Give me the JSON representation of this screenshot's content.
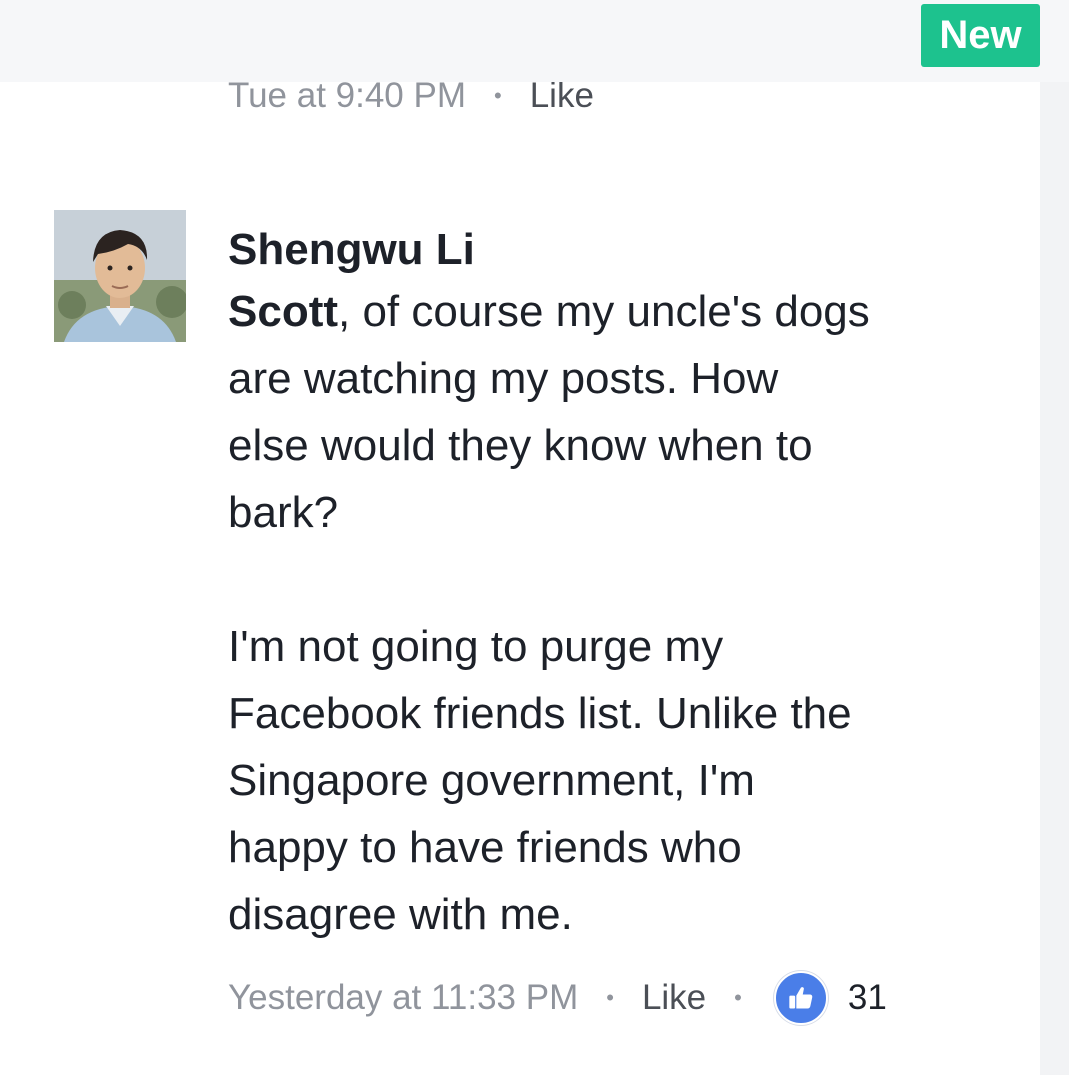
{
  "header": {
    "badge_label": "New"
  },
  "previous_comment": {
    "timestamp": "Tue at 9:40 PM",
    "separator": "•",
    "like_label": "Like"
  },
  "comment": {
    "author": "Shengwu Li",
    "mention": "Scott",
    "lines_para1_after_mention": ", of course my uncle's dogs",
    "para1_lines": [
      "are watching my posts.  How",
      "else would they know when to",
      "bark?"
    ],
    "para2_lines": [
      "I'm not going to purge my",
      "Facebook friends list.  Unlike the",
      "Singapore government, I'm",
      "happy to have friends who",
      "disagree with me."
    ],
    "timestamp": "Yesterday at 11:33 PM",
    "separator": "•",
    "like_label": "Like",
    "reaction_icon": "thumbs-up-icon",
    "reaction_count": "31"
  },
  "colors": {
    "badge": "#1dc28e",
    "reaction": "#4a7ee8",
    "meta_text": "#90949c"
  }
}
